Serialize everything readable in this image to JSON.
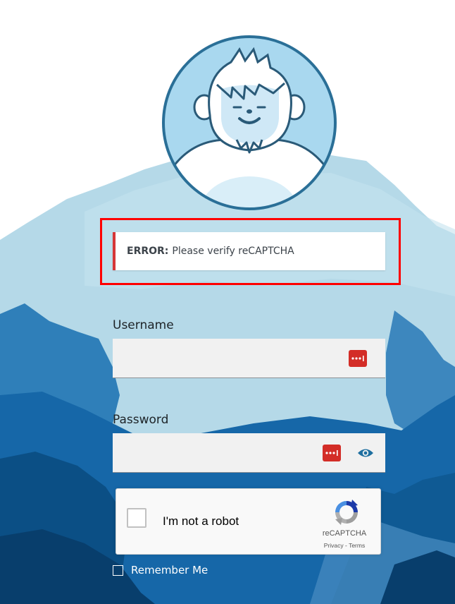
{
  "colors": {
    "error_border": "#d63638",
    "highlight_outline": "#ff0000",
    "password_manager_red": "#d32d27",
    "eye_icon": "#1e6fa0",
    "avatar_ring": "#2a6f97",
    "avatar_fill": "#a9d8ef",
    "mountain_light": "#b5d9e8",
    "mountain_dark": "#0a4f86"
  },
  "avatar": {
    "icon": "yeti-mascot-icon"
  },
  "error": {
    "prefix": "ERROR:",
    "message": "Please verify reCAPTCHA"
  },
  "login_form": {
    "username": {
      "label": "Username",
      "value": "",
      "placeholder": "",
      "icon": "password-manager-icon"
    },
    "password": {
      "label": "Password",
      "value": "",
      "placeholder": "",
      "icon": "password-manager-icon",
      "toggle_icon": "eye-icon"
    },
    "recaptcha": {
      "label": "I'm not a robot",
      "brand": "reCAPTCHA",
      "privacy": "Privacy",
      "separator": "-",
      "terms": "Terms",
      "checked": false
    },
    "remember_me": {
      "label": "Remember Me",
      "checked": false
    }
  }
}
